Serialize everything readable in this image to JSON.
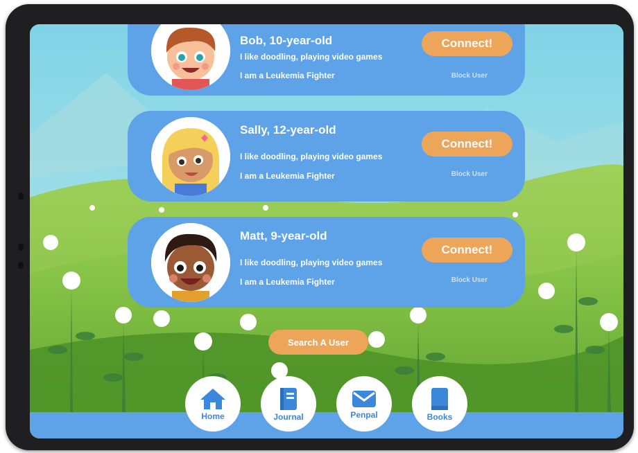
{
  "colors": {
    "card": "#5ea2e8",
    "accent_button": "#eda55a",
    "nav_text": "#3b87d9",
    "block_text": "#cfe1f7"
  },
  "users": [
    {
      "name": "Bob, 10-year-old",
      "likes": "I like doodling, playing video games",
      "condition": "I am a Leukemia Fighter",
      "connect_label": "Connect!",
      "block_label": "Block User",
      "avatar_icon": "boy-avatar-icon"
    },
    {
      "name": "Sally, 12-year-old",
      "likes": "I like doodling, playing video games",
      "condition": "I am a Leukemia Fighter",
      "connect_label": "Connect!",
      "block_label": "Block User",
      "avatar_icon": "girl-avatar-icon"
    },
    {
      "name": "Matt, 9-year-old",
      "likes": "I like doodling, playing video games",
      "condition": "I am a Leukemia Fighter",
      "connect_label": "Connect!",
      "block_label": "Block User",
      "avatar_icon": "boy-avatar-icon"
    }
  ],
  "search": {
    "label": "Search A User"
  },
  "nav": [
    {
      "label": "Home",
      "icon": "home-icon"
    },
    {
      "label": "Journal",
      "icon": "journal-icon"
    },
    {
      "label": "Penpal",
      "icon": "mail-icon"
    },
    {
      "label": "Books",
      "icon": "book-icon"
    }
  ]
}
